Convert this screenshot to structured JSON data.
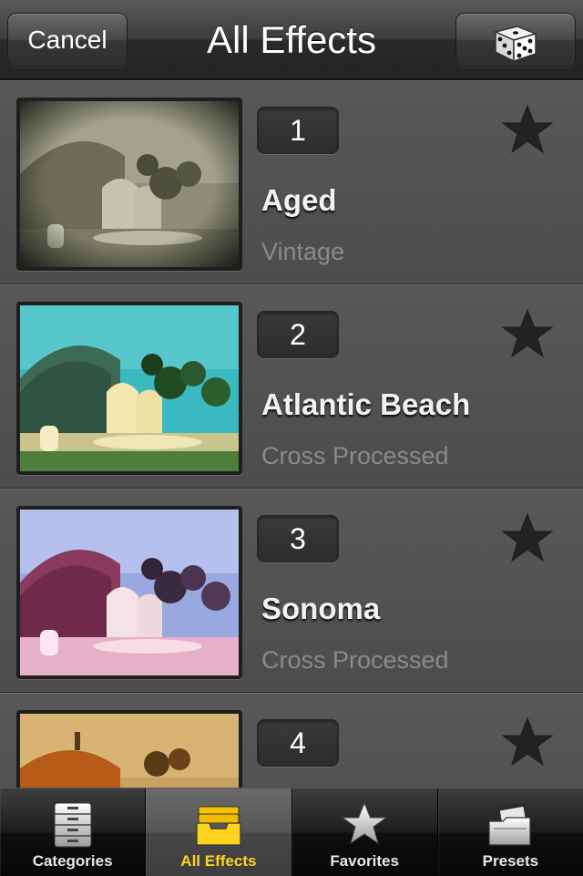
{
  "navbar": {
    "cancel_label": "Cancel",
    "title": "All Effects",
    "random_icon": "dice-icon"
  },
  "effects": [
    {
      "number": "1",
      "name": "Aged",
      "category": "Vintage",
      "favorite_icon": "star-icon"
    },
    {
      "number": "2",
      "name": "Atlantic Beach",
      "category": "Cross Processed",
      "favorite_icon": "star-icon"
    },
    {
      "number": "3",
      "name": "Sonoma",
      "category": "Cross Processed",
      "favorite_icon": "star-icon"
    },
    {
      "number": "4",
      "name": "",
      "category": "",
      "favorite_icon": "star-icon"
    }
  ],
  "tabbar": {
    "tabs": [
      {
        "label": "Categories",
        "icon": "file-cabinet-icon",
        "active": false
      },
      {
        "label": "All Effects",
        "icon": "inbox-tray-icon",
        "active": true
      },
      {
        "label": "Favorites",
        "icon": "star-icon",
        "active": false
      },
      {
        "label": "Presets",
        "icon": "folder-film-icon",
        "active": false
      }
    ],
    "active_color": "#ffd21f"
  }
}
